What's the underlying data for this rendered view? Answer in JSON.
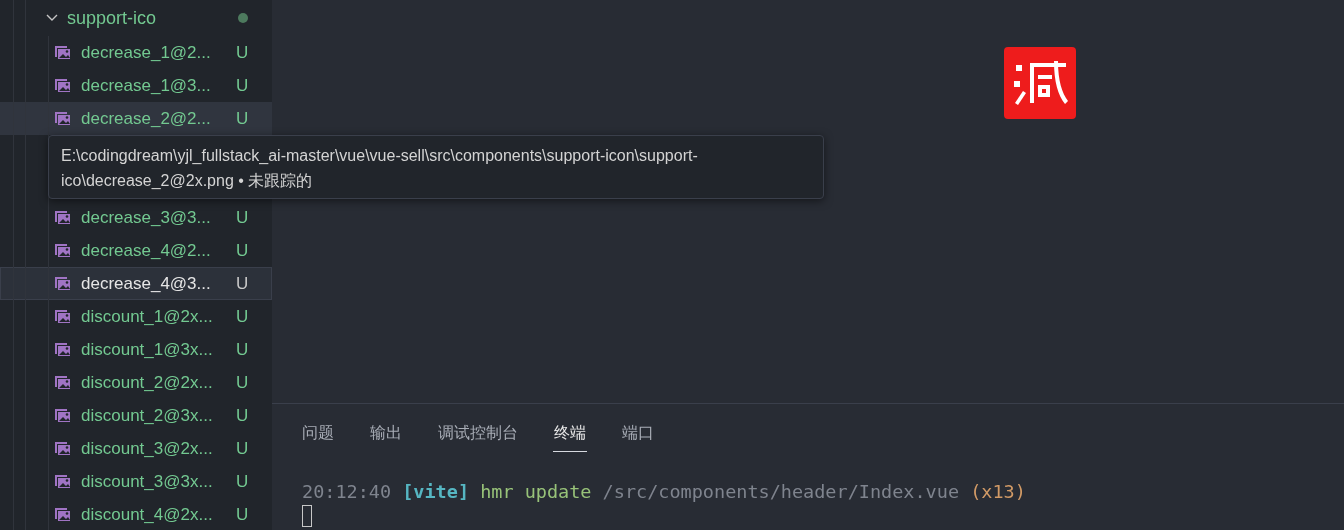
{
  "explorer": {
    "folder": {
      "name": "support-ico",
      "expanded": true
    },
    "files_above_tooltip": [
      {
        "name": "decrease_1@2...",
        "status": "U",
        "selected": false,
        "hovered": false
      },
      {
        "name": "decrease_1@3...",
        "status": "U",
        "selected": false,
        "hovered": false
      },
      {
        "name": "decrease_2@2...",
        "status": "U",
        "selected": false,
        "hovered": true
      }
    ],
    "tooltip": {
      "lines": [
        "E:\\codingdream\\yjl_fullstack_ai-master\\vue\\vue-sell\\src\\components\\support-icon\\support-",
        "ico\\decrease_2@2x.png • 未跟踪的"
      ]
    },
    "files_below_tooltip": [
      {
        "name": "decrease_3@3...",
        "status": "U",
        "selected": false,
        "hovered": false
      },
      {
        "name": "decrease_4@2...",
        "status": "U",
        "selected": false,
        "hovered": false
      },
      {
        "name": "decrease_4@3...",
        "status": "U",
        "selected": true,
        "hovered": false
      },
      {
        "name": "discount_1@2x...",
        "status": "U",
        "selected": false,
        "hovered": false
      },
      {
        "name": "discount_1@3x...",
        "status": "U",
        "selected": false,
        "hovered": false
      },
      {
        "name": "discount_2@2x...",
        "status": "U",
        "selected": false,
        "hovered": false
      },
      {
        "name": "discount_2@3x...",
        "status": "U",
        "selected": false,
        "hovered": false
      },
      {
        "name": "discount_3@2x...",
        "status": "U",
        "selected": false,
        "hovered": false
      },
      {
        "name": "discount_3@3x...",
        "status": "U",
        "selected": false,
        "hovered": false
      },
      {
        "name": "discount_4@2x...",
        "status": "U",
        "selected": false,
        "hovered": false
      }
    ]
  },
  "panel": {
    "tabs": [
      {
        "label": "问题",
        "selected": false
      },
      {
        "label": "输出",
        "selected": false
      },
      {
        "label": "调试控制台",
        "selected": false
      },
      {
        "label": "终端",
        "selected": true
      },
      {
        "label": "端口",
        "selected": false
      }
    ],
    "terminal": {
      "lines": [
        {
          "segments": [
            {
              "kind": "time",
              "text": "20:12:40"
            },
            {
              "kind": "tag",
              "text": "[vite]"
            },
            {
              "kind": "action",
              "text": "hmr update"
            },
            {
              "kind": "path",
              "text": "/src/components/header/Index.vue"
            },
            {
              "kind": "count",
              "text": "(x13)"
            }
          ]
        }
      ]
    }
  }
}
